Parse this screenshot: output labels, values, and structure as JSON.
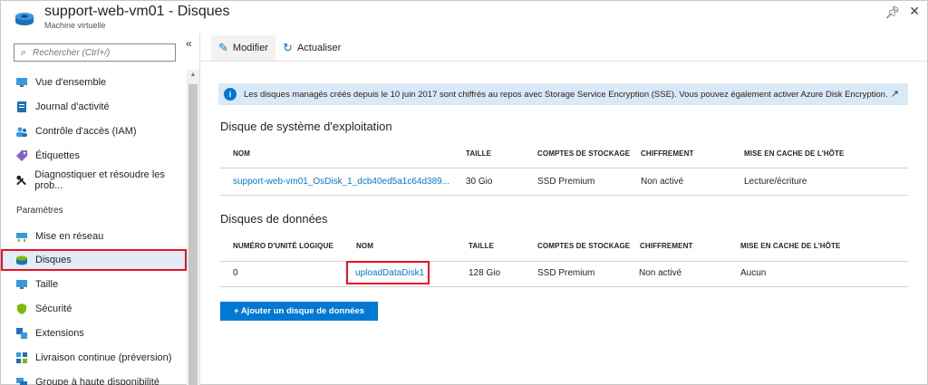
{
  "header": {
    "title": "support-web-vm01 - Disques",
    "subtitle": "Machine virtuelle"
  },
  "sidebar": {
    "search_placeholder": "Rechercher (Ctrl+/)",
    "items": [
      {
        "label": "Vue d'ensemble",
        "icon": "overview-icon"
      },
      {
        "label": "Journal d'activité",
        "icon": "activity-log-icon"
      },
      {
        "label": "Contrôle d'accès (IAM)",
        "icon": "iam-icon"
      },
      {
        "label": "Étiquettes",
        "icon": "tag-icon"
      },
      {
        "label": "Diagnostiquer et résoudre les prob...",
        "icon": "wrench-icon"
      }
    ],
    "section_settings": "Paramètres",
    "settings_items": [
      {
        "label": "Mise en réseau",
        "icon": "network-icon"
      },
      {
        "label": "Disques",
        "icon": "disk-icon",
        "selected": true
      },
      {
        "label": "Taille",
        "icon": "size-icon"
      },
      {
        "label": "Sécurité",
        "icon": "security-icon"
      },
      {
        "label": "Extensions",
        "icon": "extensions-icon"
      },
      {
        "label": "Livraison continue (préversion)",
        "icon": "continuous-delivery-icon"
      },
      {
        "label": "Groupe à haute disponibilité",
        "icon": "availability-set-icon"
      }
    ]
  },
  "toolbar": {
    "edit_label": "Modifier",
    "refresh_label": "Actualiser"
  },
  "info": {
    "text": "Les disques managés créés depuis le 10 juin 2017 sont chiffrés au repos avec Storage Service Encryption (SSE). Vous pouvez également activer Azure Disk Encryption."
  },
  "os_disk": {
    "title": "Disque de système d'exploitation",
    "headers": [
      "NOM",
      "TAILLE",
      "COMPTES DE STOCKAGE",
      "CHIFFREMENT",
      "MISE EN CACHE DE L'HÔTE"
    ],
    "row": [
      "support-web-vm01_OsDisk_1_dcb40ed5a1c64d389...",
      "30 Gio",
      "SSD Premium",
      "Non activé",
      "Lecture/écriture"
    ]
  },
  "data_disks": {
    "title": "Disques de données",
    "headers": [
      "NUMÉRO D'UNITÉ LOGIQUE",
      "NOM",
      "TAILLE",
      "COMPTES DE STOCKAGE",
      "CHIFFREMENT",
      "MISE EN CACHE DE L'HÔTE"
    ],
    "row": [
      "0",
      "uploadDataDisk1",
      "128 Gio",
      "SSD Premium",
      "Non activé",
      "Aucun"
    ]
  },
  "add_button": "+ Ajouter un disque de données",
  "colors": {
    "accent": "#0078d4",
    "highlight": "#e81123"
  }
}
